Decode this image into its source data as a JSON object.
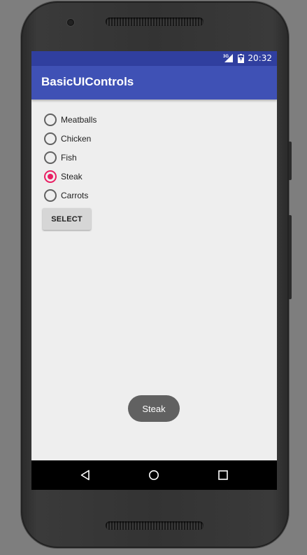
{
  "status_bar": {
    "network": "3G",
    "time": "20:32"
  },
  "app_bar": {
    "title": "BasicUIControls"
  },
  "radio_group": {
    "options": [
      {
        "label": "Meatballs",
        "checked": false
      },
      {
        "label": "Chicken",
        "checked": false
      },
      {
        "label": "Fish",
        "checked": false
      },
      {
        "label": "Steak",
        "checked": true
      },
      {
        "label": "Carrots",
        "checked": false
      }
    ]
  },
  "select_button": {
    "label": "SELECT"
  },
  "toast": {
    "message": "Steak"
  },
  "nav_bar": {
    "icons": [
      "back-icon",
      "home-icon",
      "recents-icon"
    ]
  },
  "colors": {
    "status_bar": "#303f9f",
    "app_bar": "#3f51b5",
    "accent": "#e91e63",
    "background": "#eeeeee"
  }
}
